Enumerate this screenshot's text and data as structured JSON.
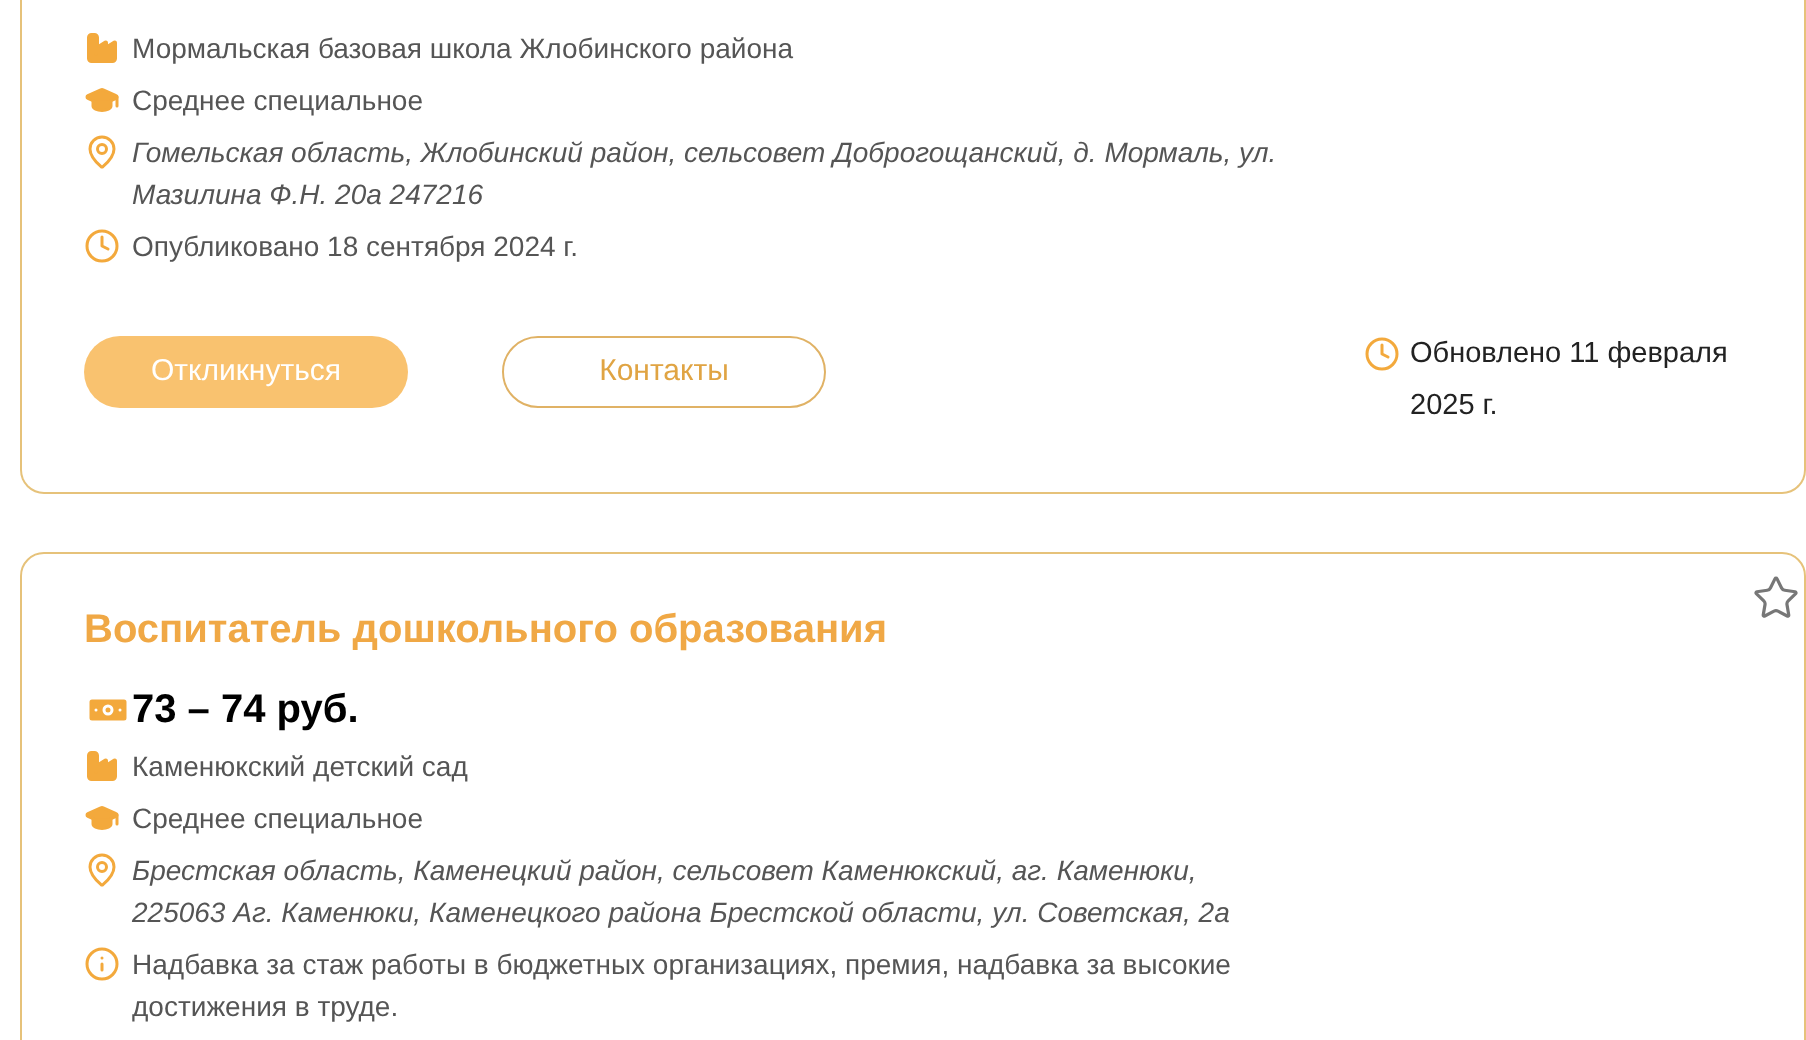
{
  "vacancies": [
    {
      "employer": "Мормальская базовая школа Жлобинского района",
      "education": "Среднее специальное",
      "address": "Гомельская область, Жлобинский район, сельсовет Доброгощанский, д. Мормаль, ул. Мазилина Ф.Н. 20а 247216",
      "published": "Опубликовано 18 сентября 2024 г.",
      "buttons": [
        {
          "label": "Откликнуться",
          "kind": "filled"
        },
        {
          "label": "Контакты",
          "kind": "outline"
        }
      ],
      "updated": "Обновлено 11 февраля 2025 г."
    },
    {
      "title": "Воспитатель дошкольного образования",
      "salary": "73 – 74 руб.",
      "favorite": false,
      "employer": "Каменюкский детский сад",
      "education": "Среднее специальное",
      "address": "Брестская область, Каменецкий район, сельсовет Каменюкский, аг. Каменюки, 225063 Аг. Каменюки, Каменецкого района Брестской области, ул. Советская, 2а",
      "info": "Надбавка за стаж работы в бюджетных организациях, премия, надбавка за высокие достижения в труде."
    }
  ]
}
